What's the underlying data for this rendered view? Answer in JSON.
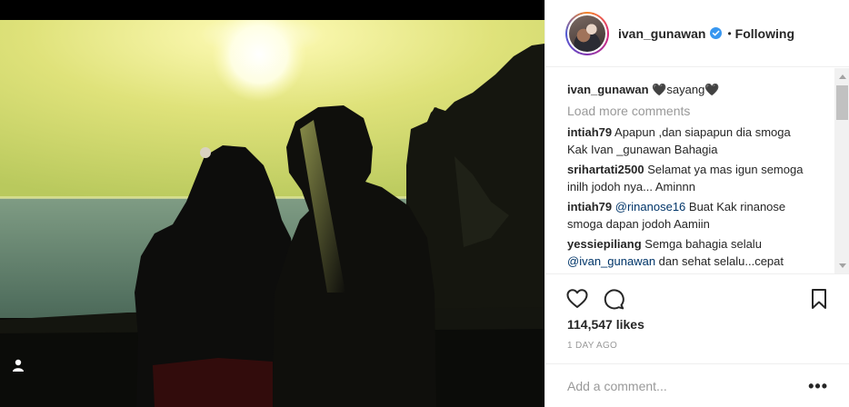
{
  "post": {
    "username": "ivan_gunawan",
    "verified": true,
    "follow_status": "Following",
    "separator": "•"
  },
  "comments": {
    "caption": {
      "user": "ivan_gunawan",
      "text": "🖤sayang🖤"
    },
    "load_more": "Load more comments",
    "items": [
      {
        "user": "intiah79",
        "text": "Apapun ,dan siapapun dia smoga Kak Ivan _gunawan Bahagia"
      },
      {
        "user": "srihartati2500",
        "text": "Selamat ya mas igun semoga inilh jodoh nya... Aminnn"
      },
      {
        "user": "intiah79",
        "mention": "@rinanose16",
        "text": "Buat Kak rinanose smoga dapan jodoh Aamiin"
      },
      {
        "user": "yessiepiliang",
        "text": "Semga bahagia selalu",
        "mention2": "@ivan_gunawan",
        "text2": "dan sehat selalu...cepat"
      }
    ]
  },
  "actions": {
    "likes": "114,547 likes",
    "timestamp": "1 DAY AGO",
    "icons": [
      "heart-icon",
      "comment-icon",
      "bookmark-icon"
    ]
  },
  "add_comment": {
    "placeholder": "Add a comment...",
    "more_label": "•••"
  },
  "colors": {
    "link": "#003569",
    "muted": "#999999",
    "verified": "#3897f0",
    "text": "#262626"
  }
}
